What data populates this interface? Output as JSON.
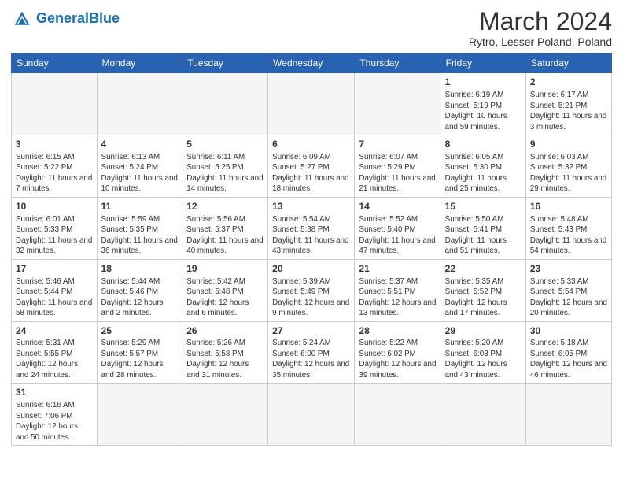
{
  "header": {
    "logo_general": "General",
    "logo_blue": "Blue",
    "month_title": "March 2024",
    "location": "Rytro, Lesser Poland, Poland"
  },
  "days_of_week": [
    "Sunday",
    "Monday",
    "Tuesday",
    "Wednesday",
    "Thursday",
    "Friday",
    "Saturday"
  ],
  "weeks": [
    [
      {
        "num": "",
        "info": ""
      },
      {
        "num": "",
        "info": ""
      },
      {
        "num": "",
        "info": ""
      },
      {
        "num": "",
        "info": ""
      },
      {
        "num": "",
        "info": ""
      },
      {
        "num": "1",
        "info": "Sunrise: 6:19 AM\nSunset: 5:19 PM\nDaylight: 10 hours and 59 minutes."
      },
      {
        "num": "2",
        "info": "Sunrise: 6:17 AM\nSunset: 5:21 PM\nDaylight: 11 hours and 3 minutes."
      }
    ],
    [
      {
        "num": "3",
        "info": "Sunrise: 6:15 AM\nSunset: 5:22 PM\nDaylight: 11 hours and 7 minutes."
      },
      {
        "num": "4",
        "info": "Sunrise: 6:13 AM\nSunset: 5:24 PM\nDaylight: 11 hours and 10 minutes."
      },
      {
        "num": "5",
        "info": "Sunrise: 6:11 AM\nSunset: 5:25 PM\nDaylight: 11 hours and 14 minutes."
      },
      {
        "num": "6",
        "info": "Sunrise: 6:09 AM\nSunset: 5:27 PM\nDaylight: 11 hours and 18 minutes."
      },
      {
        "num": "7",
        "info": "Sunrise: 6:07 AM\nSunset: 5:29 PM\nDaylight: 11 hours and 21 minutes."
      },
      {
        "num": "8",
        "info": "Sunrise: 6:05 AM\nSunset: 5:30 PM\nDaylight: 11 hours and 25 minutes."
      },
      {
        "num": "9",
        "info": "Sunrise: 6:03 AM\nSunset: 5:32 PM\nDaylight: 11 hours and 29 minutes."
      }
    ],
    [
      {
        "num": "10",
        "info": "Sunrise: 6:01 AM\nSunset: 5:33 PM\nDaylight: 11 hours and 32 minutes."
      },
      {
        "num": "11",
        "info": "Sunrise: 5:59 AM\nSunset: 5:35 PM\nDaylight: 11 hours and 36 minutes."
      },
      {
        "num": "12",
        "info": "Sunrise: 5:56 AM\nSunset: 5:37 PM\nDaylight: 11 hours and 40 minutes."
      },
      {
        "num": "13",
        "info": "Sunrise: 5:54 AM\nSunset: 5:38 PM\nDaylight: 11 hours and 43 minutes."
      },
      {
        "num": "14",
        "info": "Sunrise: 5:52 AM\nSunset: 5:40 PM\nDaylight: 11 hours and 47 minutes."
      },
      {
        "num": "15",
        "info": "Sunrise: 5:50 AM\nSunset: 5:41 PM\nDaylight: 11 hours and 51 minutes."
      },
      {
        "num": "16",
        "info": "Sunrise: 5:48 AM\nSunset: 5:43 PM\nDaylight: 11 hours and 54 minutes."
      }
    ],
    [
      {
        "num": "17",
        "info": "Sunrise: 5:46 AM\nSunset: 5:44 PM\nDaylight: 11 hours and 58 minutes."
      },
      {
        "num": "18",
        "info": "Sunrise: 5:44 AM\nSunset: 5:46 PM\nDaylight: 12 hours and 2 minutes."
      },
      {
        "num": "19",
        "info": "Sunrise: 5:42 AM\nSunset: 5:48 PM\nDaylight: 12 hours and 6 minutes."
      },
      {
        "num": "20",
        "info": "Sunrise: 5:39 AM\nSunset: 5:49 PM\nDaylight: 12 hours and 9 minutes."
      },
      {
        "num": "21",
        "info": "Sunrise: 5:37 AM\nSunset: 5:51 PM\nDaylight: 12 hours and 13 minutes."
      },
      {
        "num": "22",
        "info": "Sunrise: 5:35 AM\nSunset: 5:52 PM\nDaylight: 12 hours and 17 minutes."
      },
      {
        "num": "23",
        "info": "Sunrise: 5:33 AM\nSunset: 5:54 PM\nDaylight: 12 hours and 20 minutes."
      }
    ],
    [
      {
        "num": "24",
        "info": "Sunrise: 5:31 AM\nSunset: 5:55 PM\nDaylight: 12 hours and 24 minutes."
      },
      {
        "num": "25",
        "info": "Sunrise: 5:29 AM\nSunset: 5:57 PM\nDaylight: 12 hours and 28 minutes."
      },
      {
        "num": "26",
        "info": "Sunrise: 5:26 AM\nSunset: 5:58 PM\nDaylight: 12 hours and 31 minutes."
      },
      {
        "num": "27",
        "info": "Sunrise: 5:24 AM\nSunset: 6:00 PM\nDaylight: 12 hours and 35 minutes."
      },
      {
        "num": "28",
        "info": "Sunrise: 5:22 AM\nSunset: 6:02 PM\nDaylight: 12 hours and 39 minutes."
      },
      {
        "num": "29",
        "info": "Sunrise: 5:20 AM\nSunset: 6:03 PM\nDaylight: 12 hours and 43 minutes."
      },
      {
        "num": "30",
        "info": "Sunrise: 5:18 AM\nSunset: 6:05 PM\nDaylight: 12 hours and 46 minutes."
      }
    ],
    [
      {
        "num": "31",
        "info": "Sunrise: 6:16 AM\nSunset: 7:06 PM\nDaylight: 12 hours and 50 minutes."
      },
      {
        "num": "",
        "info": ""
      },
      {
        "num": "",
        "info": ""
      },
      {
        "num": "",
        "info": ""
      },
      {
        "num": "",
        "info": ""
      },
      {
        "num": "",
        "info": ""
      },
      {
        "num": "",
        "info": ""
      }
    ]
  ]
}
